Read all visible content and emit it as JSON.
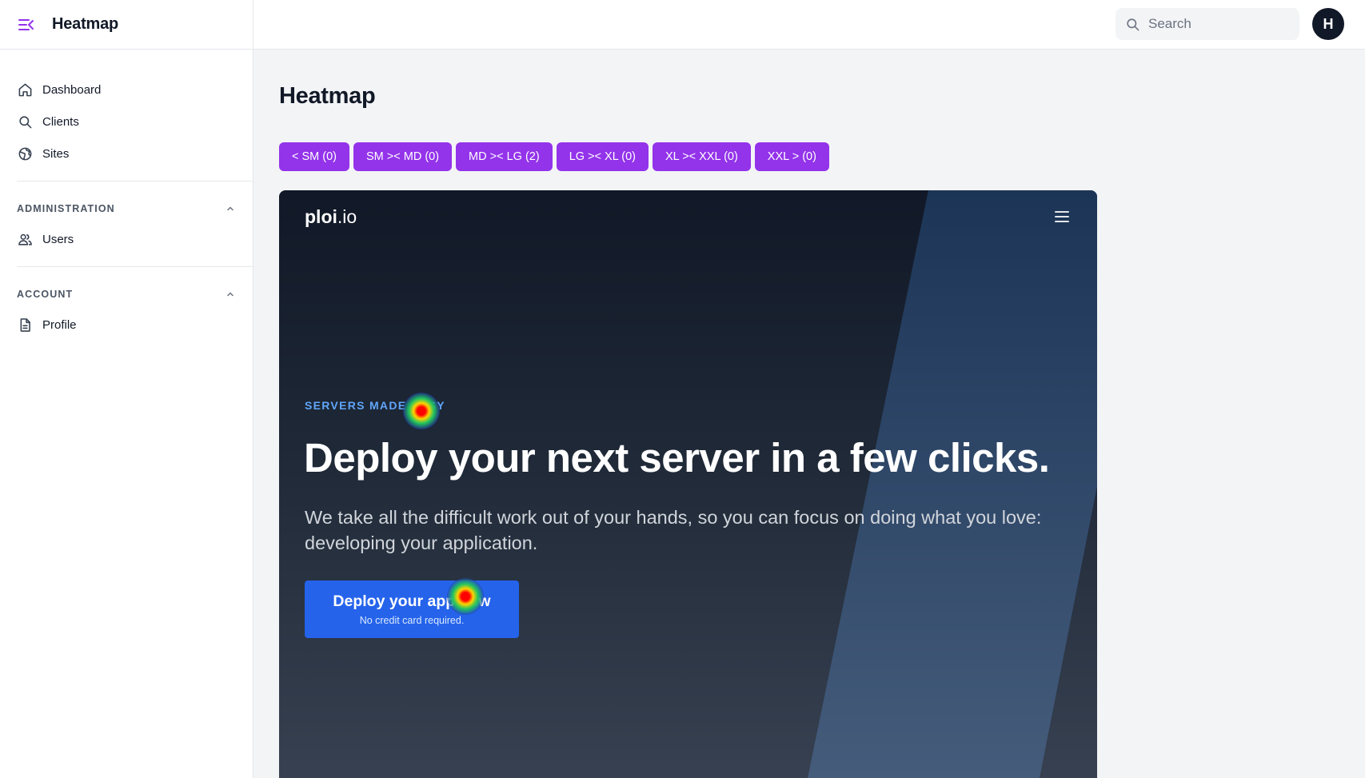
{
  "app": {
    "title": "Heatmap"
  },
  "sidebar": {
    "items": [
      {
        "label": "Dashboard",
        "icon": "home-icon"
      },
      {
        "label": "Clients",
        "icon": "search-icon"
      },
      {
        "label": "Sites",
        "icon": "globe-icon"
      }
    ],
    "groups": [
      {
        "label": "ADMINISTRATION",
        "expanded": true,
        "items": [
          {
            "label": "Users",
            "icon": "users-icon"
          }
        ]
      },
      {
        "label": "ACCOUNT",
        "expanded": true,
        "items": [
          {
            "label": "Profile",
            "icon": "document-icon"
          }
        ]
      }
    ]
  },
  "topbar": {
    "search_placeholder": "Search",
    "avatar_initial": "H"
  },
  "main": {
    "page_title": "Heatmap",
    "breakpoints": [
      "< SM (0)",
      "SM >< MD (0)",
      "MD >< LG (2)",
      "LG >< XL (0)",
      "XL >< XXL (0)",
      "XXL > (0)"
    ]
  },
  "preview": {
    "logo_bold": "ploi",
    "logo_rest": ".io",
    "tagline": "SERVERS MADE EASY",
    "headline": "Deploy your next server in a few clicks.",
    "subheadline": "We take all the difficult work out of your hands, so you can focus on doing what you love: developing your application.",
    "cta_label": "Deploy your app now",
    "cta_note": "No credit card required."
  },
  "colors": {
    "accent": "#9333ea",
    "cta": "#2563eb",
    "tagline": "#60a5fa",
    "avatar": "#111827"
  }
}
